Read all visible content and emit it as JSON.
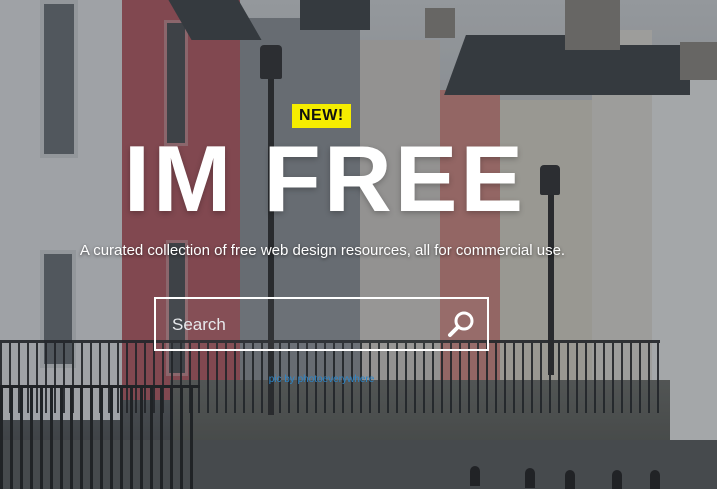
{
  "hero": {
    "badge": "NEW!",
    "title": "IM FREE",
    "tagline": "A curated collection of free web design resources, all for commercial use.",
    "search": {
      "placeholder": "Search",
      "value": "",
      "icon": "search-icon"
    },
    "credit": "pic by photoeverywhere"
  },
  "colors": {
    "badge_bg": "#f5ed00",
    "text": "#ffffff",
    "credit_link": "#2c86c9"
  }
}
